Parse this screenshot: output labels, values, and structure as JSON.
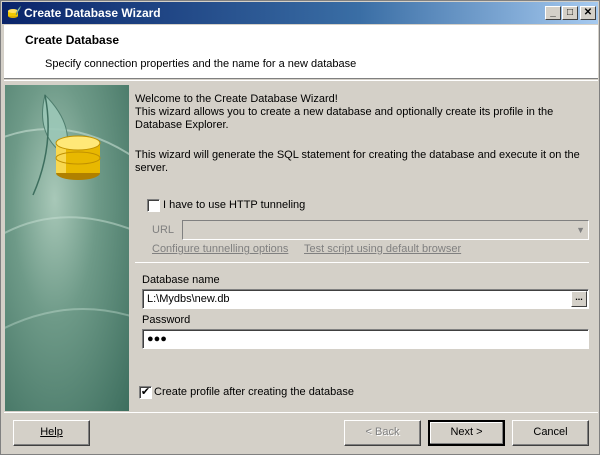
{
  "window": {
    "title": "Create Database Wizard",
    "minimize": "_",
    "maximize": "□",
    "close": "✕"
  },
  "header": {
    "title": "Create Database",
    "subtitle": "Specify connection properties and the name for a new database"
  },
  "intro": {
    "line1": "Welcome to the Create Database Wizard!",
    "line2": "This wizard allows you to create a new database and optionally create its profile in the Database Explorer.",
    "line3": "This wizard will generate the SQL statement for creating the database and execute it on the server."
  },
  "http": {
    "checkbox_label": "I have to use HTTP tunneling",
    "checked": false,
    "url_label": "URL",
    "url_value": "",
    "link_configure": "Configure tunnelling options",
    "link_test": "Test script using default browser"
  },
  "database": {
    "name_label": "Database name",
    "name_value": "L:\\Mydbs\\new.db",
    "browse_label": "...",
    "password_label": "Password",
    "password_value": "●●●"
  },
  "profile": {
    "checkbox_label": "Create profile after creating the database",
    "checked": true,
    "check_mark": "✔"
  },
  "buttons": {
    "help": "Help",
    "back": "< Back",
    "next": "Next >",
    "cancel": "Cancel"
  },
  "icons": {
    "app": "database-feather-icon",
    "sidebar": "database-cylinder-icon"
  },
  "colors": {
    "titlebar_start": "#0a246a",
    "titlebar_end": "#a6caf0",
    "window_bg": "#d4d0c8",
    "sidebar": "#6e9a88"
  }
}
